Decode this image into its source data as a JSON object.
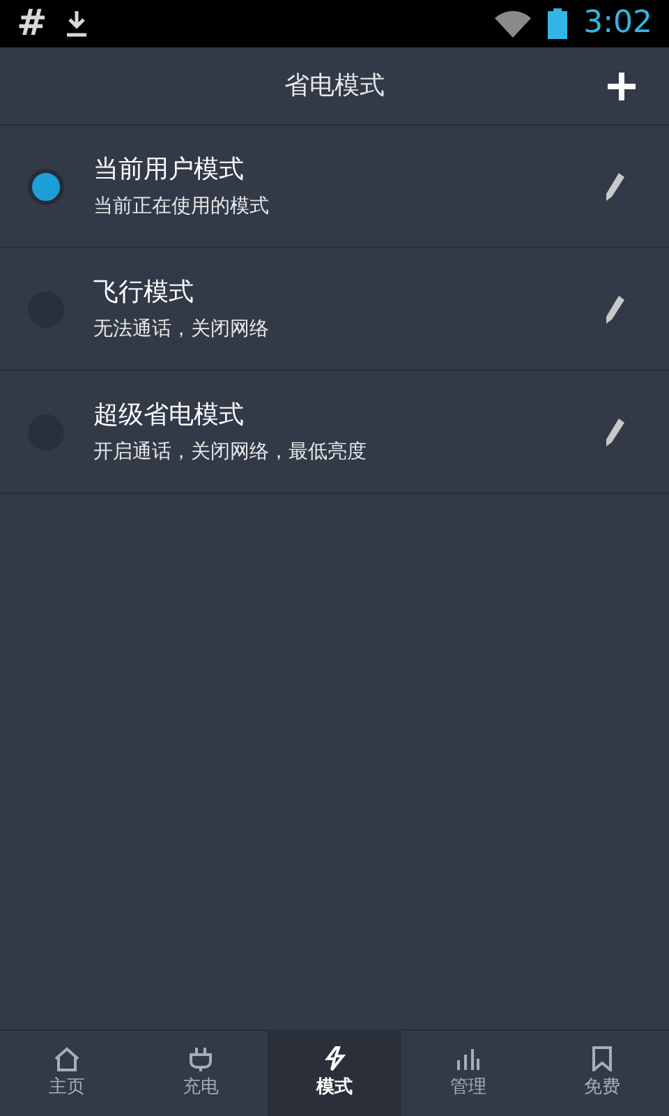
{
  "status_bar": {
    "glyph": "#",
    "time": "3:02"
  },
  "header": {
    "title": "省电模式"
  },
  "modes": [
    {
      "name": "当前用户模式",
      "description": "当前正在使用的模式",
      "selected": true
    },
    {
      "name": "飞行模式",
      "description": "无法通话，关闭网络",
      "selected": false
    },
    {
      "name": "超级省电模式",
      "description": "开启通话，关闭网络，最低亮度",
      "selected": false
    }
  ],
  "tabs": [
    {
      "label": "主页",
      "selected": false
    },
    {
      "label": "充电",
      "selected": false
    },
    {
      "label": "模式",
      "selected": true
    },
    {
      "label": "管理",
      "selected": false
    },
    {
      "label": "免费",
      "selected": false
    }
  ]
}
